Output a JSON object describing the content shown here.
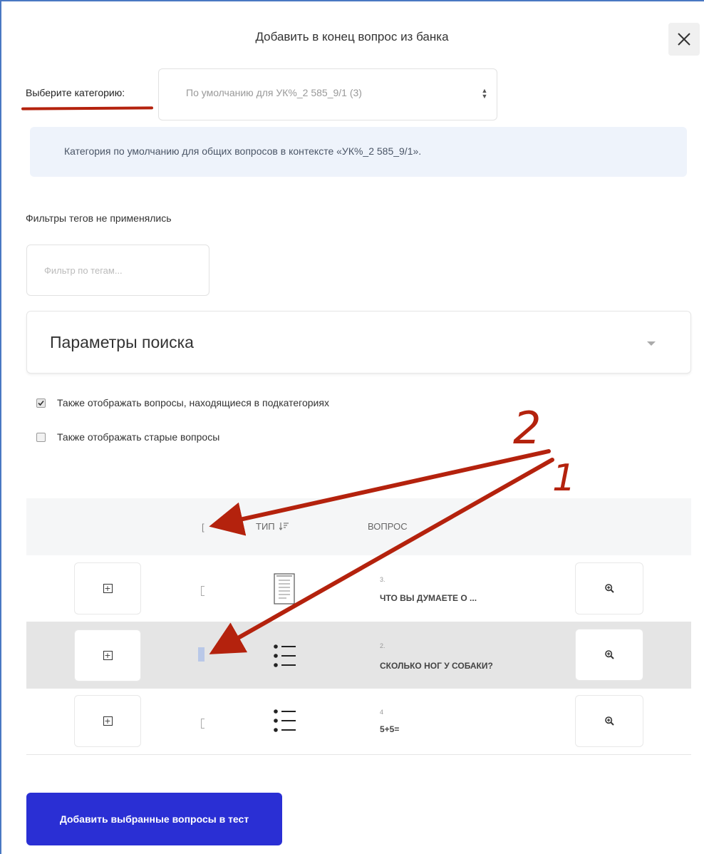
{
  "modal": {
    "title": "Добавить в конец вопрос из банка"
  },
  "category": {
    "label": "Выберите категорию:",
    "selected": "По умолчанию для УК%_2 585_9/1 (3)"
  },
  "info": {
    "text": "Категория по умолчанию для общих вопросов в контексте «УК%_2 585_9/1»."
  },
  "tags": {
    "status": "Фильтры тегов не применялись",
    "placeholder": "Фильтр по тегам..."
  },
  "search_params": {
    "title": "Параметры поиска"
  },
  "options": [
    {
      "label": "Также отображать вопросы, находящиеся в подкатегориях",
      "checked": true
    },
    {
      "label": "Также отображать старые вопросы",
      "checked": false
    }
  ],
  "table": {
    "headers": {
      "type": "ТИП",
      "question": "ВОПРОС"
    },
    "rows": [
      {
        "number": "3.",
        "text": "ЧТО ВЫ ДУМАЕТЕ О ...",
        "type_icon": "essay-document-icon",
        "highlighted": false
      },
      {
        "number": "2.",
        "text": "СКОЛЬКО НОГ У СОБАКИ?",
        "type_icon": "multichoice-list-icon",
        "highlighted": true
      },
      {
        "number": "4",
        "text": "5+5=",
        "type_icon": "multichoice-list-icon",
        "highlighted": false
      }
    ]
  },
  "submit": {
    "label": "Добавить выбранные вопросы в тест"
  },
  "annotations": {
    "label_1": "1",
    "label_2": "2",
    "color": "#b4220d"
  },
  "colors": {
    "primary_button": "#2a2fd4",
    "info_background": "#eef3fb",
    "highlight_row": "#e5e5e5"
  }
}
